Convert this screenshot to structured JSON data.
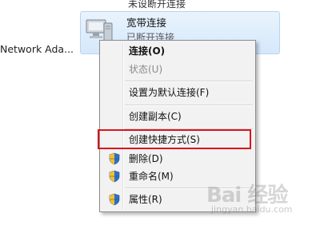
{
  "background": {
    "top_fragment": "未设断开连接",
    "left_label": "Network Ada...",
    "connection": {
      "name": "宽带连接",
      "status": "已断开连接",
      "icon": "network-computer-icon"
    }
  },
  "context_menu": {
    "items": [
      {
        "label": "连接(O)",
        "bold": true
      },
      {
        "label": "状态(U)",
        "disabled": true
      },
      {
        "label": "设置为默认连接(F)"
      },
      {
        "label": "创建副本(C)"
      },
      {
        "label": "创建快捷方式(S)",
        "highlighted": true
      },
      {
        "label": "删除(D)",
        "icon": "uac-shield-icon"
      },
      {
        "label": "重命名(M)",
        "icon": "uac-shield-icon"
      },
      {
        "label": "属性(R)",
        "icon": "uac-shield-icon"
      }
    ],
    "highlight_color": "#d9141b"
  },
  "watermark": {
    "logo_text": "Bai 经验",
    "url": "jingyan.baidu.com"
  }
}
